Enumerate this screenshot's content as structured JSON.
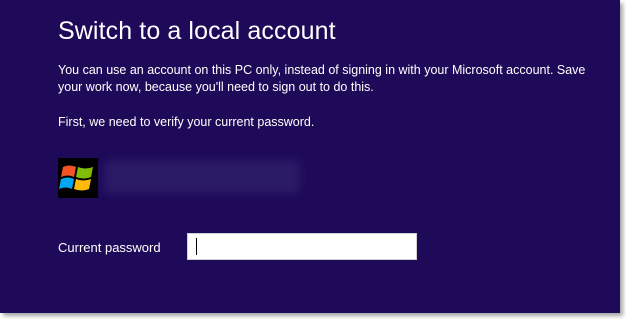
{
  "dialog": {
    "title": "Switch to a local account",
    "description": "You can use an account on this PC only, instead of signing in with your Microsoft account. Save your work now, because you'll need to sign out to do this.",
    "verify_prompt": "First, we need to verify your current password."
  },
  "account": {
    "avatar_icon": "windows-logo-icon"
  },
  "password": {
    "label": "Current password",
    "value": ""
  },
  "colors": {
    "background": "#1e0a58",
    "text": "#ffffff",
    "input_bg": "#ffffff"
  }
}
